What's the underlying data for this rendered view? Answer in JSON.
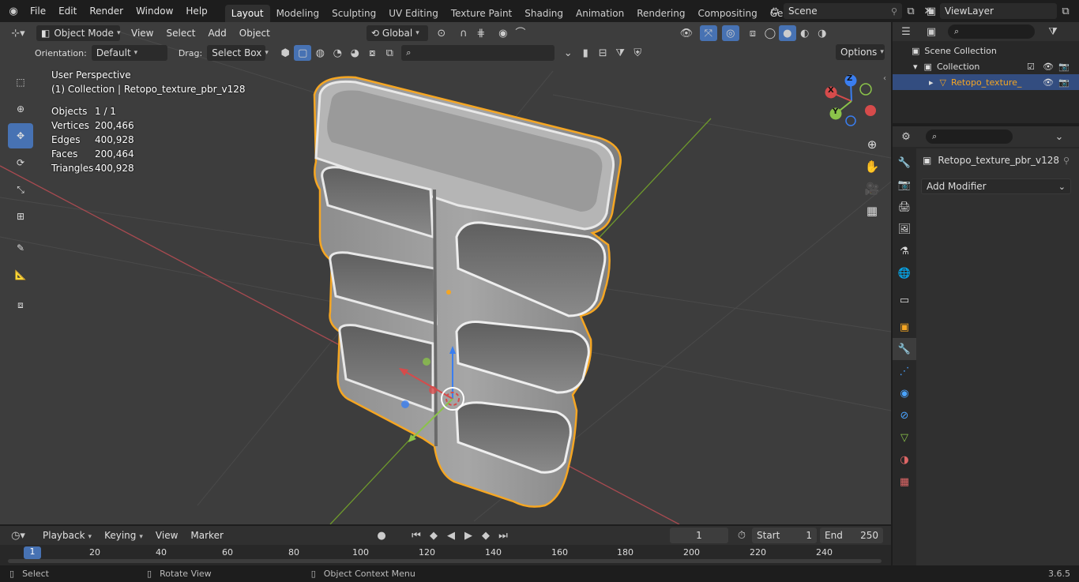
{
  "topbar": {
    "menu": [
      "File",
      "Edit",
      "Render",
      "Window",
      "Help"
    ],
    "workspaces": [
      "Layout",
      "Modeling",
      "Sculpting",
      "UV Editing",
      "Texture Paint",
      "Shading",
      "Animation",
      "Rendering",
      "Compositing",
      "Geometry Noc"
    ],
    "scene": "Scene",
    "view_layer": "ViewLayer"
  },
  "header": {
    "mode": "Object Mode",
    "menus": [
      "View",
      "Select",
      "Add",
      "Object"
    ],
    "transform_orientation": "Global"
  },
  "tool_settings": {
    "orientation_label": "Orientation:",
    "orientation_value": "Default",
    "drag_label": "Drag:",
    "drag_value": "Select Box",
    "options": "Options"
  },
  "overlay": {
    "perspective": "User Perspective",
    "collection": "(1) Collection | Retopo_texture_pbr_v128",
    "stats": [
      {
        "label": "Objects",
        "value": "1 / 1"
      },
      {
        "label": "Vertices",
        "value": "200,466"
      },
      {
        "label": "Edges",
        "value": "400,928"
      },
      {
        "label": "Faces",
        "value": "200,464"
      },
      {
        "label": "Triangles",
        "value": "400,928"
      }
    ]
  },
  "gizmo": {
    "x": "X",
    "y": "Y",
    "z": "Z"
  },
  "outliner": {
    "scene_collection": "Scene Collection",
    "collection": "Collection",
    "object": "Retopo_texture_"
  },
  "properties": {
    "object_name": "Retopo_texture_pbr_v128",
    "add_modifier": "Add Modifier"
  },
  "timeline": {
    "menus": [
      "Playback",
      "Keying",
      "View",
      "Marker"
    ],
    "current_frame": "1",
    "start_label": "Start",
    "start": "1",
    "end_label": "End",
    "end": "250",
    "ruler": [
      "1",
      "20",
      "40",
      "60",
      "80",
      "100",
      "120",
      "140",
      "160",
      "180",
      "200",
      "220",
      "240"
    ]
  },
  "statusbar": {
    "select": "Select",
    "rotate": "Rotate View",
    "context": "Object Context Menu",
    "version": "3.6.5"
  },
  "colors": {
    "accent": "#4772b3",
    "selection": "#f5a623",
    "x_axis": "#d64b4b",
    "y_axis": "#8bc34a",
    "z_axis": "#3a7ef0"
  }
}
